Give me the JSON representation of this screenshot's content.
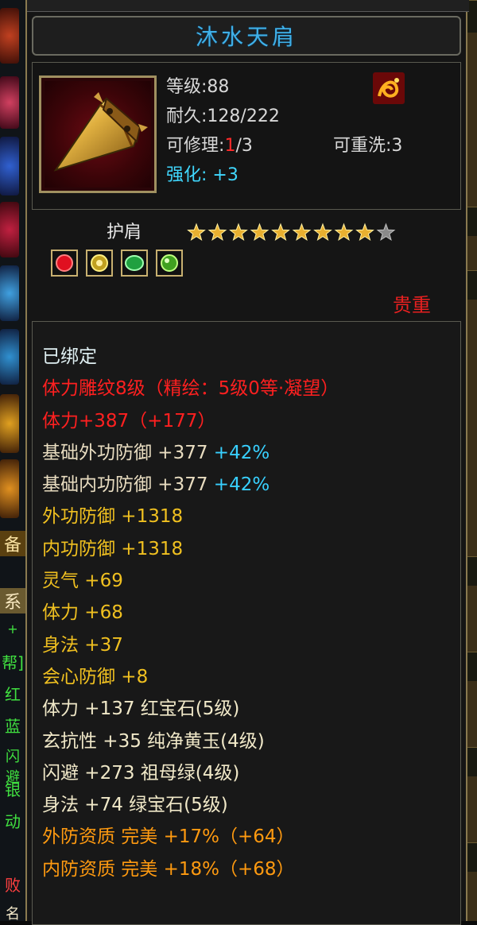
{
  "left_strip": {
    "glyphs": [
      "备",
      "系",
      "+",
      "帮]",
      "红",
      "蓝",
      "闪避",
      "银",
      "动",
      "败",
      "名"
    ]
  },
  "item": {
    "name": "沐水天肩",
    "level_label": "等级",
    "level_value": ":88",
    "durability_label": "耐久",
    "durability_value": ":128/222",
    "repair_label": "可修理",
    "repair_colon": ":",
    "repair_used": "1",
    "repair_max": "/3",
    "rewash_label": "可重洗",
    "rewash_value": ":3",
    "enhance_label": "强化",
    "enhance_value": ": +3",
    "type": "护肩",
    "stars_filled": 9,
    "stars_total": 10,
    "rarity": "贵重",
    "icon": "shoulder-armor-icon",
    "gems": [
      "ruby-gem-icon",
      "yellow-jade-gem-icon",
      "emerald-gem-icon",
      "green-gem-icon"
    ]
  },
  "properties": [
    {
      "text": "已绑定",
      "style": "white"
    },
    {
      "text": "体力雕纹8级（精绘：5级0等·凝望）",
      "style": "red"
    },
    {
      "text": "体力+387（+177）",
      "style": "red"
    },
    {
      "text": "基础外功防御 +377",
      "extra": "+42%",
      "style": "base"
    },
    {
      "text": "基础内功防御 +377",
      "extra": "+42%",
      "style": "base"
    },
    {
      "text": "外功防御 +1318",
      "style": "yellow"
    },
    {
      "text": "内功防御 +1318",
      "style": "yellow"
    },
    {
      "text": "灵气 +69",
      "style": "yellow"
    },
    {
      "text": "体力 +68",
      "style": "yellow"
    },
    {
      "text": "身法 +37",
      "style": "yellow"
    },
    {
      "text": "会心防御 +8",
      "style": "yellow"
    },
    {
      "text": "体力 +137 红宝石(5级)",
      "style": "light"
    },
    {
      "text": "玄抗性 +35 纯净黄玉(4级)",
      "style": "light"
    },
    {
      "text": "闪避 +273 祖母绿(4级)",
      "style": "light"
    },
    {
      "text": "身法 +74 绿宝石(5级)",
      "style": "light"
    },
    {
      "text": "外防资质  完美 +17%（+64）",
      "style": "orange"
    },
    {
      "text": "内防资质  完美 +18%（+68）",
      "style": "orange"
    }
  ],
  "colors": {
    "title": "#3fb0e8",
    "bound": "#dfeff2",
    "engrave": "#ff2020",
    "base": "#e8dcc0",
    "bonus_pct": "#38d0ff",
    "attribute": "#f0c020",
    "gem_line": "#f0e8c8",
    "aptitude": "#ff9a10",
    "rarity": "#e82020"
  }
}
